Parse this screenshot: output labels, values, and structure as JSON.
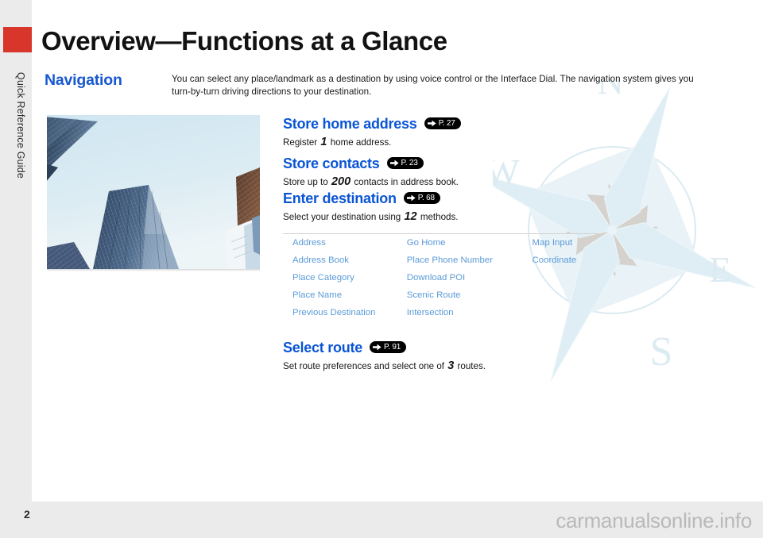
{
  "document": {
    "title": "Overview—Functions at a Glance",
    "page_number": "2",
    "watermark": "carmanualsonline.info",
    "side_tab_label": "Quick Reference Guide",
    "side_tab_color": "#d8352b"
  },
  "colors": {
    "heading_blue": "#0a55d6",
    "section_blue": "#1858d0",
    "table_blue": "#5b9bd8",
    "badge_bg": "#000000",
    "page_bg": "#ebebeb",
    "paper_bg": "#ffffff",
    "compass_tint": "#dcebf2"
  },
  "section": {
    "label": "Navigation",
    "intro": "You can select any place/landmark as a destination by using voice control or the Interface Dial. The navigation system gives you turn-by-turn driving directions to your destination."
  },
  "photo": {
    "alt": "Skyscrapers viewed from below against a pale blue sky"
  },
  "compass": {
    "north": "N",
    "west": "W",
    "east": "E",
    "south": "S"
  },
  "features": [
    {
      "heading": "Store home address",
      "page_ref": "P. 27",
      "desc_before": "Register ",
      "desc_number": "1",
      "desc_after": " home address."
    },
    {
      "heading": "Store contacts",
      "page_ref": "P. 23",
      "desc_before": "Store up to ",
      "desc_number": "200",
      "desc_after": " contacts in address book."
    },
    {
      "heading": "Enter destination",
      "page_ref": "P. 68",
      "desc_before": "Select your destination using ",
      "desc_number": "12",
      "desc_after": " methods."
    },
    {
      "heading": "Select route",
      "page_ref": "P. 91",
      "desc_before": "Set route preferences and select one of ",
      "desc_number": "3",
      "desc_after": " routes."
    }
  ],
  "methods_table": {
    "rows": [
      [
        "Address",
        "Go Home",
        "Map Input"
      ],
      [
        "Address Book",
        "Place Phone Number",
        "Coordinate"
      ],
      [
        "Place Category",
        "Download POI",
        ""
      ],
      [
        "Place Name",
        "Scenic Route",
        ""
      ],
      [
        "Previous Destination",
        "Intersection",
        ""
      ]
    ]
  }
}
